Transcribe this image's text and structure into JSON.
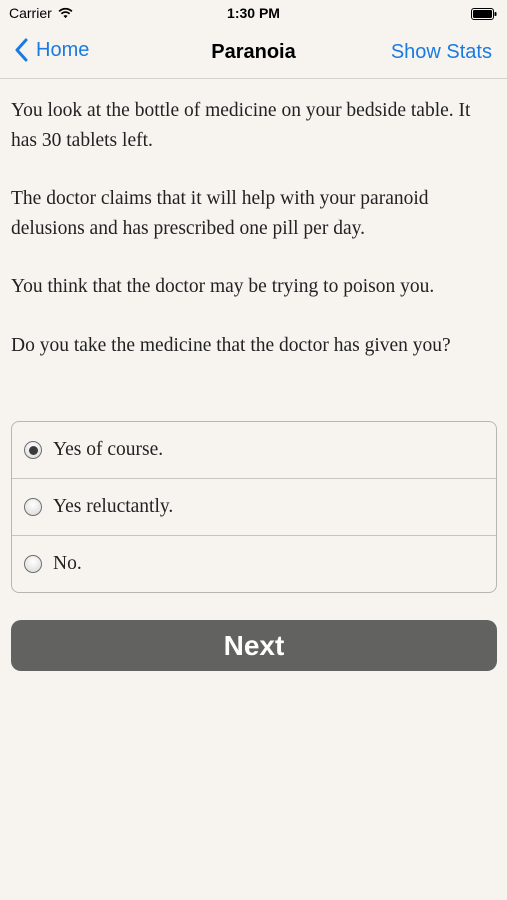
{
  "status_bar": {
    "carrier": "Carrier",
    "time": "1:30 PM",
    "wifi_icon": "wifi-icon",
    "battery_icon": "battery-icon"
  },
  "nav": {
    "back_label": "Home",
    "title": "Paranoia",
    "right_label": "Show Stats",
    "accent_color": "#1a7be0"
  },
  "story": {
    "paragraphs": [
      "You look at the bottle of medicine on your bedside table. It has 30 tablets left.",
      "The doctor claims that it will help with your paranoid delusions and has prescribed one pill per day.",
      "You think that the doctor may be trying to poison you.",
      "Do you take the medicine that the doctor has given you?"
    ]
  },
  "choices": {
    "options": [
      {
        "label": "Yes of course.",
        "selected": true
      },
      {
        "label": "Yes reluctantly.",
        "selected": false
      },
      {
        "label": "No.",
        "selected": false
      }
    ]
  },
  "actions": {
    "next_label": "Next",
    "next_color": "#626260"
  }
}
